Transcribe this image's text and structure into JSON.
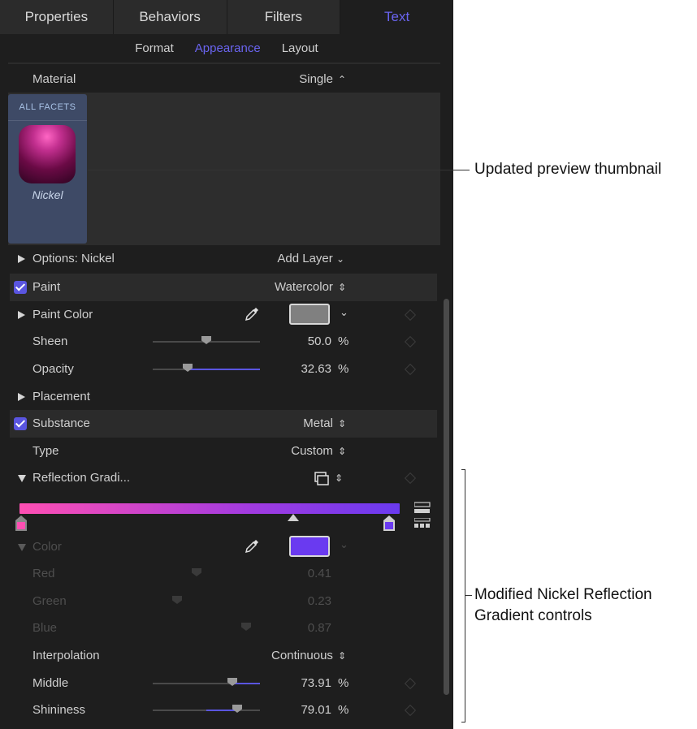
{
  "tabs": [
    {
      "label": "Properties"
    },
    {
      "label": "Behaviors"
    },
    {
      "label": "Filters"
    },
    {
      "label": "Text"
    }
  ],
  "subtabs": [
    {
      "label": "Format"
    },
    {
      "label": "Appearance"
    },
    {
      "label": "Layout"
    }
  ],
  "material": {
    "label": "Material",
    "value": "Single"
  },
  "facet": {
    "header": "ALL FACETS",
    "name": "Nickel"
  },
  "options": {
    "label": "Options: Nickel",
    "add_layer": "Add Layer"
  },
  "paint": {
    "label": "Paint",
    "value": "Watercolor",
    "checked": true
  },
  "paint_color": {
    "label": "Paint Color",
    "swatch": "#808080"
  },
  "sheen": {
    "label": "Sheen",
    "value": "50.0",
    "unit": "%",
    "level": 0.5
  },
  "opacity": {
    "label": "Opacity",
    "value": "32.63",
    "unit": "%",
    "level": 0.3263
  },
  "placement": {
    "label": "Placement"
  },
  "substance": {
    "label": "Substance",
    "value": "Metal",
    "checked": true
  },
  "type": {
    "label": "Type",
    "value": "Custom"
  },
  "reflection": {
    "label": "Reflection Gradi..."
  },
  "gradient": {
    "start_color": "#ff4fb3",
    "end_color": "#6a3af0"
  },
  "color": {
    "label": "Color",
    "swatch": "#6a3af0"
  },
  "red": {
    "label": "Red",
    "value": "0.41",
    "level": 0.41
  },
  "green": {
    "label": "Green",
    "value": "0.23",
    "level": 0.23
  },
  "blue": {
    "label": "Blue",
    "value": "0.87",
    "level": 0.87
  },
  "interpolation": {
    "label": "Interpolation",
    "value": "Continuous"
  },
  "middle": {
    "label": "Middle",
    "value": "73.91",
    "unit": "%",
    "level": 0.7391
  },
  "shininess": {
    "label": "Shininess",
    "value": "79.01",
    "unit": "%",
    "level": 0.7901
  },
  "callouts": {
    "thumbnail": "Updated preview thumbnail",
    "gradient": "Modified Nickel Reflection Gradient controls"
  },
  "colors": {
    "accent": "#5a55e0",
    "active_tab": "#6a64f0",
    "panel_bg": "#1e1e1e"
  }
}
